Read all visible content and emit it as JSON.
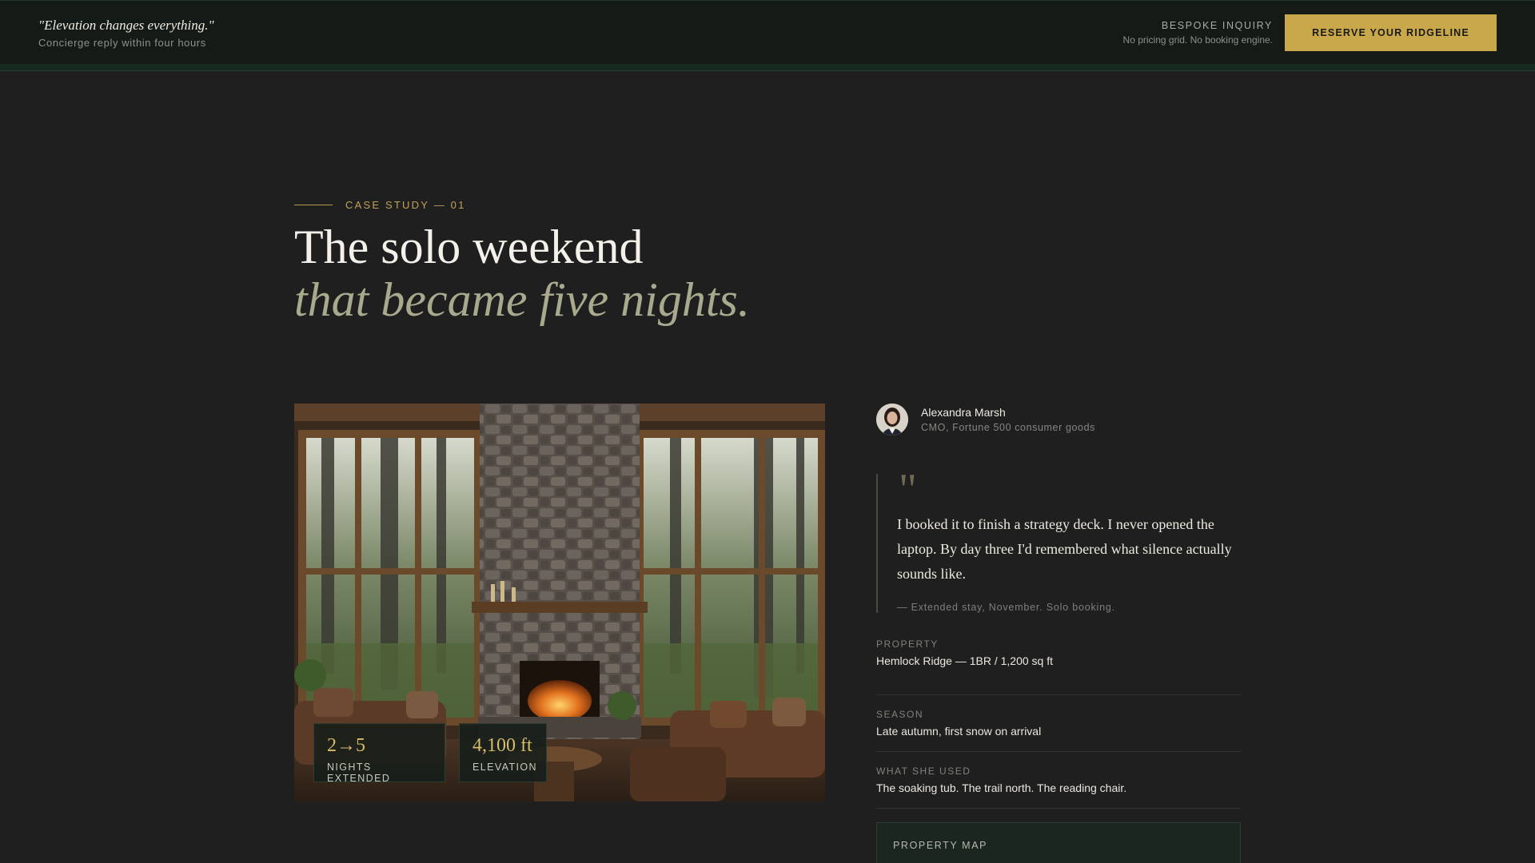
{
  "header": {
    "tagline": "\"Elevation changes everything.\"",
    "subline": "Concierge reply within four hours",
    "inquiry_label": "BESPOKE INQUIRY",
    "inquiry_note": "No pricing grid. No booking engine.",
    "cta_label": "RESERVE YOUR RIDGELINE"
  },
  "hero": {
    "eyebrow": "CASE STUDY — 01",
    "title_line1": "The solo weekend",
    "title_line2": "that became five nights."
  },
  "photo": {
    "subject": "Cabin living room with stone fireplace and forest windows",
    "stats": [
      {
        "value": "2→5",
        "label": "NIGHTS EXTENDED"
      },
      {
        "value": "4,100 ft",
        "label": "ELEVATION"
      }
    ]
  },
  "testimonial": {
    "name": "Alexandra Marsh",
    "role": "CMO, Fortune 500 consumer goods",
    "quote_mark": "\"",
    "quote": "I booked it to finish a strategy deck. I never opened the laptop. By day three I'd remembered what silence actually sounds like.",
    "citation": "— Extended stay, November. Solo booking."
  },
  "details": [
    {
      "label": "PROPERTY",
      "value": "Hemlock Ridge — 1BR / 1,200 sq ft"
    },
    {
      "label": "SEASON",
      "value": "Late autumn, first snow on arrival"
    },
    {
      "label": "WHAT SHE USED",
      "value": "The soaking tub. The trail north. The reading chair."
    }
  ],
  "map": {
    "title": "PROPERTY MAP"
  },
  "colors": {
    "accent_gold": "#c9a84c",
    "header_bg": "#141b17",
    "page_bg": "#1f1f1f"
  }
}
